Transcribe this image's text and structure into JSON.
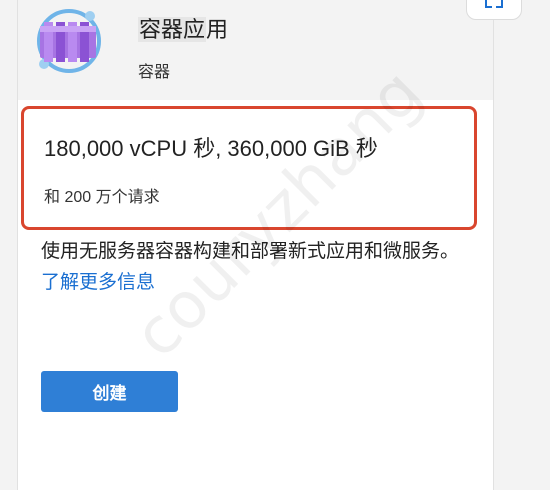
{
  "service": {
    "title_prefix": "容器应",
    "title_suffix": "用",
    "category": "容器",
    "icon": "container-apps-icon"
  },
  "pricing": {
    "main": "180,000 vCPU 秒, 360,000 GiB 秒",
    "sub": "和 200 万个请求"
  },
  "description": {
    "text": "使用无服务器容器构建和部署新式应用和微服务。",
    "link_label": "了解更多信息"
  },
  "actions": {
    "create_label": "创建"
  },
  "watermark": "couryzhang",
  "colors": {
    "highlight_border": "#d9462e",
    "primary_button": "#2f7fd6",
    "link": "#1a6fd1"
  }
}
